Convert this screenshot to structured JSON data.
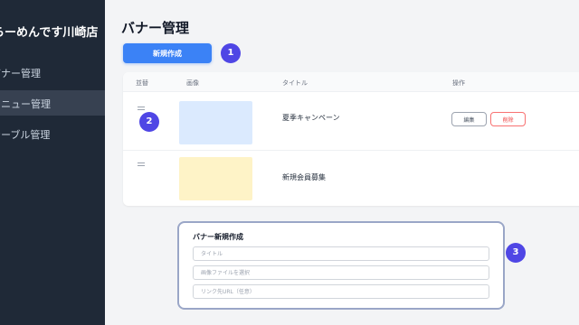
{
  "sidebar": {
    "shop_name": "らーめんです川崎店",
    "items": [
      {
        "label": "バナー管理"
      },
      {
        "label": "メニュー管理"
      },
      {
        "label": "テーブル管理"
      }
    ]
  },
  "page": {
    "title": "バナー管理"
  },
  "toolbar": {
    "new_label": "新規作成"
  },
  "steps": [
    "1",
    "2",
    "3"
  ],
  "table": {
    "headers": [
      "並替",
      "画像",
      "タイトル",
      "操作"
    ],
    "rows": [
      {
        "title": "夏季キャンペーン",
        "thumb_color": "#dbeafe"
      },
      {
        "title": "新規会員募集",
        "thumb_color": "#fef3c7"
      }
    ],
    "edit_label": "編集",
    "delete_label": "削除"
  },
  "form": {
    "title": "バナー新規作成",
    "title_placeholder": "タイトル",
    "image_placeholder": "画像ファイルを選択",
    "link_placeholder": "リンク先URL（任意）"
  },
  "colors": {
    "sidebar_bg": "#1f2937",
    "primary": "#3b82f6",
    "step_badge": "#4f46e5",
    "danger": "#ef4444"
  }
}
